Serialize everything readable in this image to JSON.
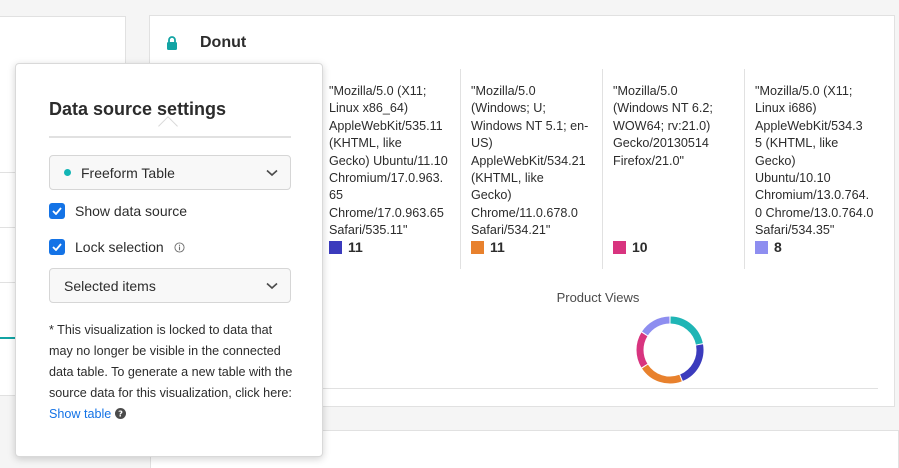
{
  "visualization": {
    "title": "Donut",
    "metric_label": "Product Views",
    "columns": [
      {
        "user_agent": "\"Mozilla/5.0 (X11;\nLinux x86_64)\nAppleWebKit/535.11\n(KHTML, like\nGecko) Ubuntu/11.10\nChromium/17.0.963.\n65\nChrome/17.0.963.65\nSafari/535.11\"",
        "value": "11",
        "color": "#3b3bbd"
      },
      {
        "user_agent": "\"Mozilla/5.0\n(Windows; U;\nWindows NT 5.1; en-\nUS)\nAppleWebKit/534.21\n(KHTML, like\nGecko)\nChrome/11.0.678.0\nSafari/534.21\"",
        "value": "11",
        "color": "#e8812d"
      },
      {
        "user_agent": "\"Mozilla/5.0\n(Windows NT 6.2;\nWOW64; rv:21.0)\nGecko/20130514\nFirefox/21.0\"",
        "value": "10",
        "color": "#d8347f"
      },
      {
        "user_agent": "\"Mozilla/5.0 (X11;\nLinux i686)\nAppleWebKit/534.3\n5 (KHTML, like\nGecko)\nUbuntu/10.10\nChromium/13.0.764.\n0 Chrome/13.0.764.0\nSafari/534.35\"",
        "value": "8",
        "color": "#8e8ef0"
      }
    ],
    "donut_segments": [
      {
        "color": "#1fb5b5",
        "share": 0.22
      },
      {
        "color": "#3b3bbd",
        "share": 0.22
      },
      {
        "color": "#e8812d",
        "share": 0.22
      },
      {
        "color": "#d8347f",
        "share": 0.18
      },
      {
        "color": "#8e8ef0",
        "share": 0.16
      }
    ]
  },
  "popover": {
    "title": "Data source settings",
    "source_dropdown": {
      "value": "Freeform Table"
    },
    "show_data_source": {
      "label": "Show data source",
      "checked": true
    },
    "lock_selection": {
      "label": "Lock selection",
      "checked": true
    },
    "selection_dropdown": {
      "value": "Selected items"
    },
    "note_text": "* This visualization is locked to data that may no longer be visible in the connected data table. To generate a new table with the source data for this visualization, click here: ",
    "note_link": "Show table"
  },
  "colors": {
    "accent": "#1473e6",
    "teal": "#12a4a4"
  }
}
